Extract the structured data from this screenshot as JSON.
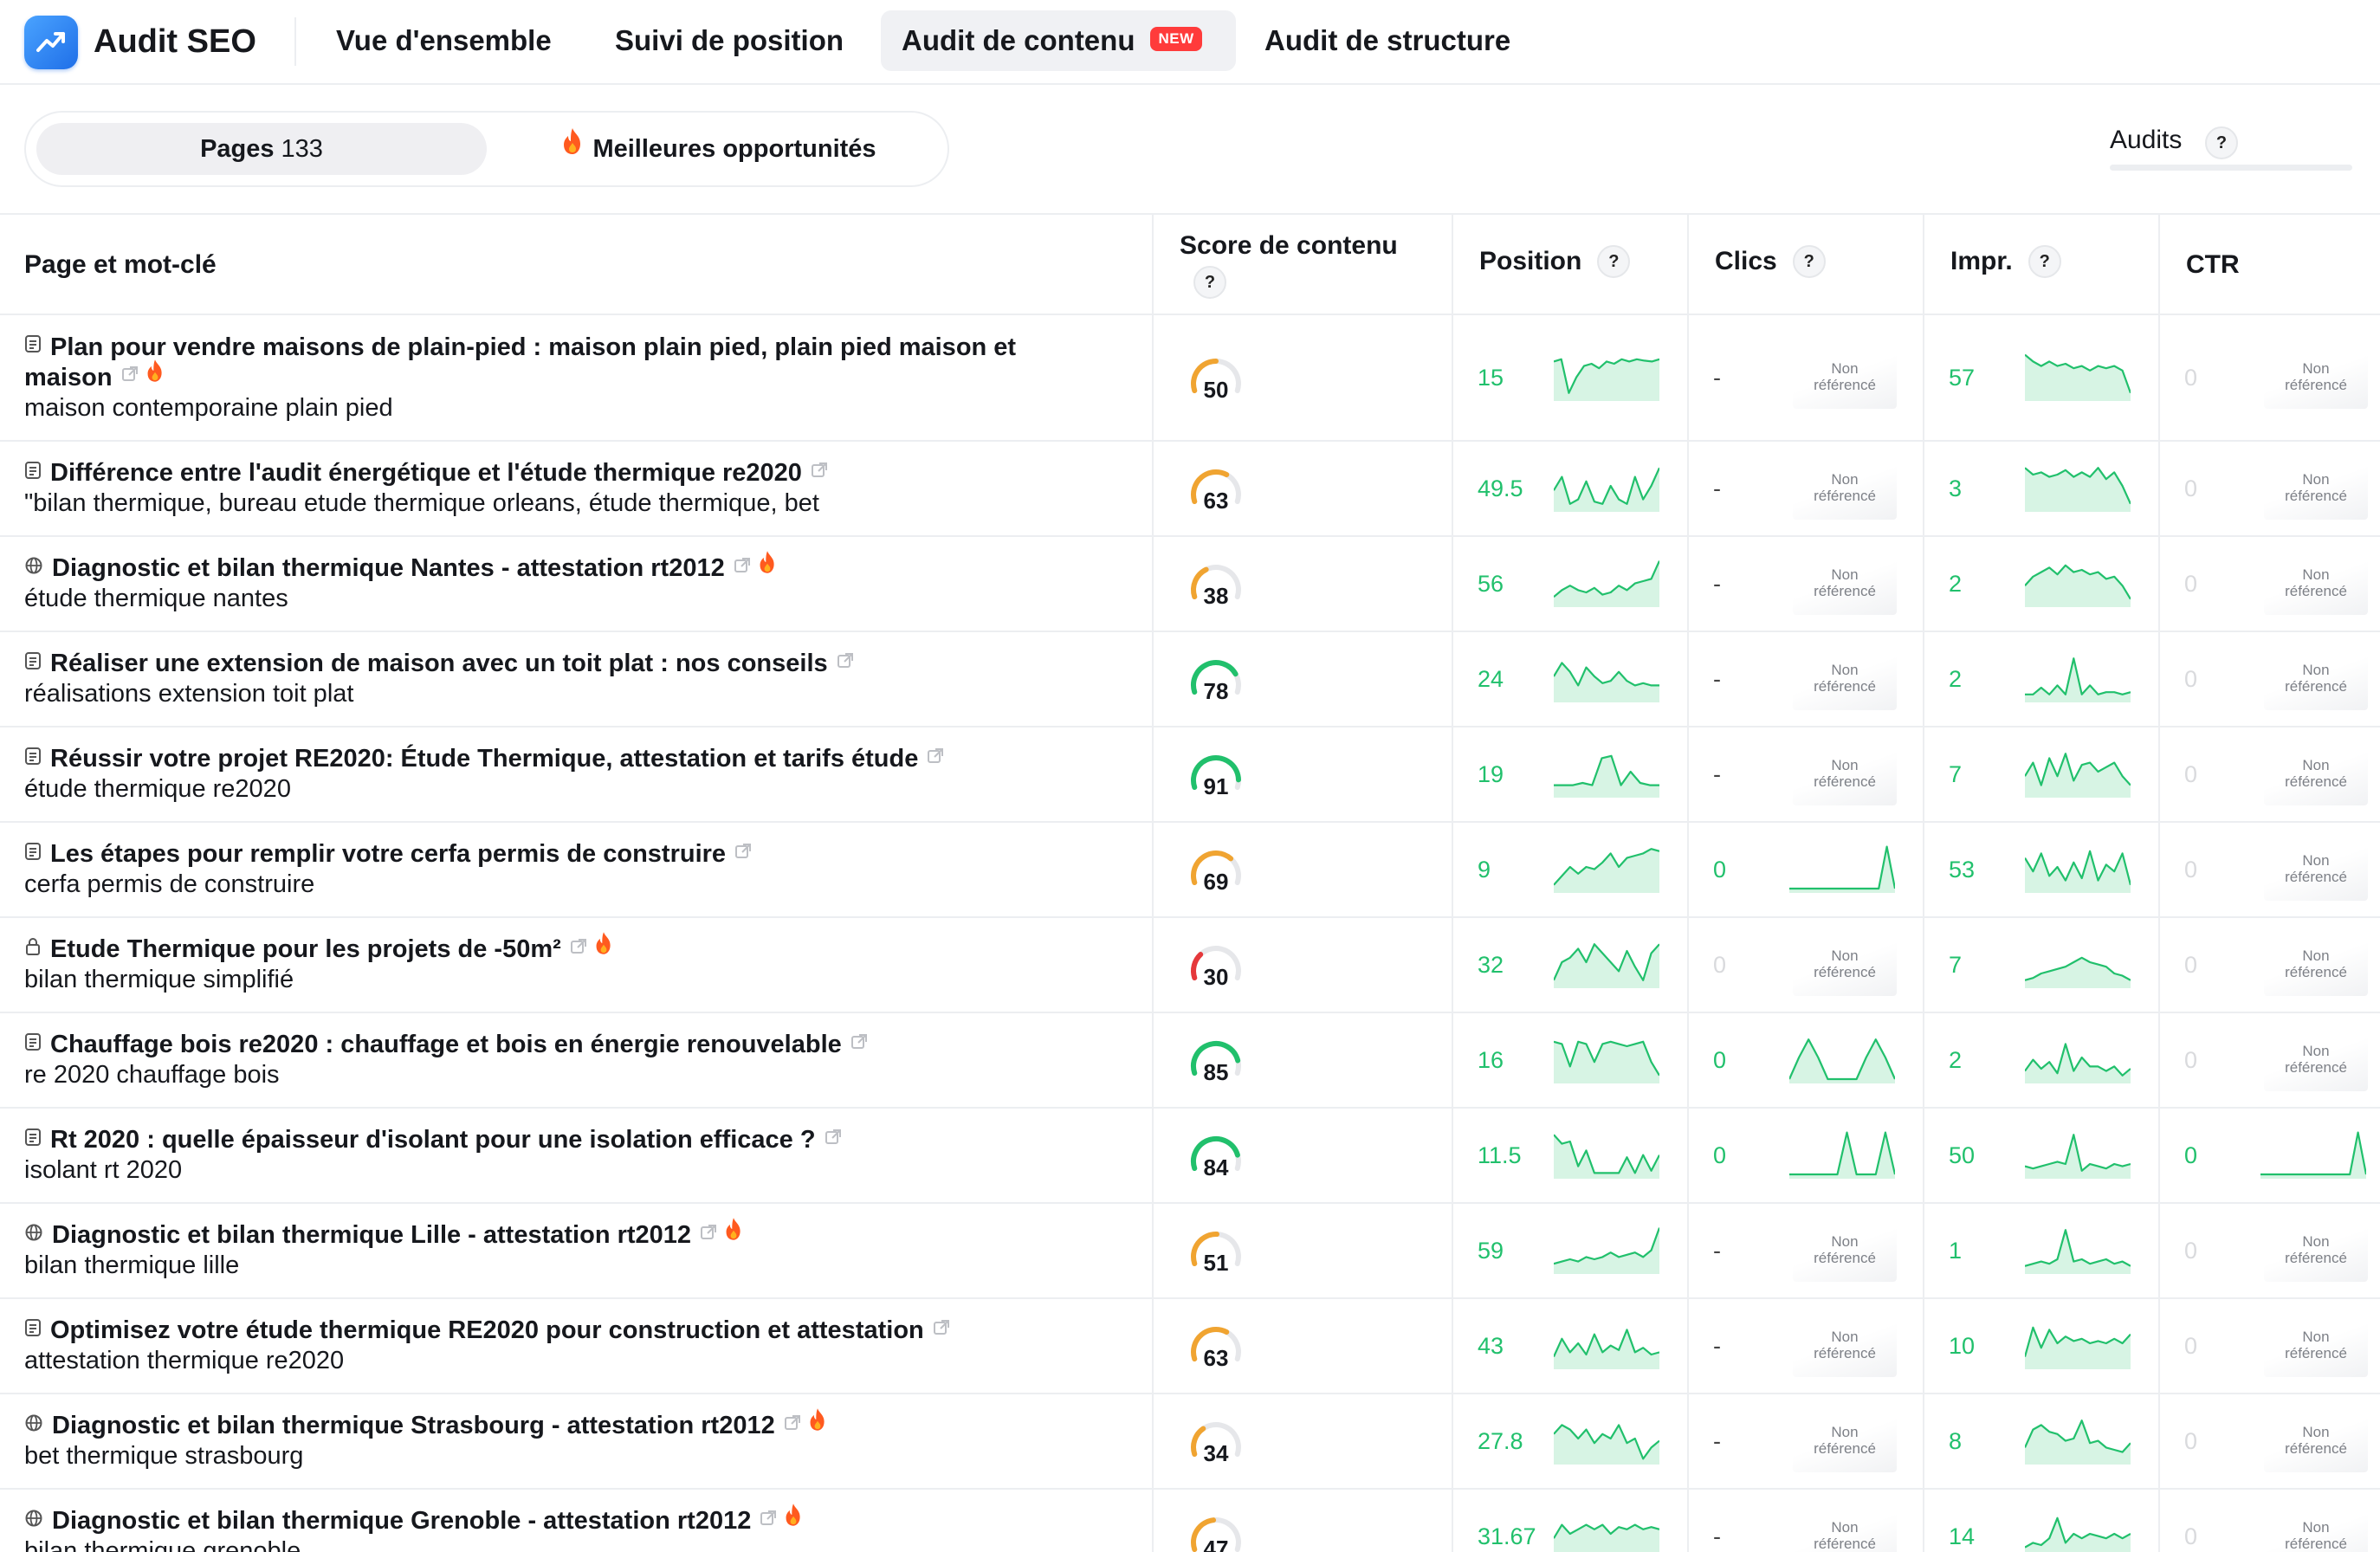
{
  "app": {
    "title": "Audit SEO"
  },
  "nav": {
    "tabs": [
      {
        "label": "Vue d'ensemble",
        "active": false
      },
      {
        "label": "Suivi de position",
        "active": false
      },
      {
        "label": "Audit de contenu",
        "active": true,
        "badge": "NEW"
      },
      {
        "label": "Audit de structure",
        "active": false
      }
    ]
  },
  "filters": {
    "pages_label": "Pages",
    "pages_count": "133",
    "opportunities_label": "Meilleures opportunités"
  },
  "audits": {
    "label": "Audits",
    "help": "?"
  },
  "table": {
    "columns": {
      "page": "Page et mot-clé",
      "score": "Score de contenu",
      "position": "Position",
      "clicks": "Clics",
      "impressions": "Impr.",
      "ctr": "CTR"
    },
    "help": "?",
    "non_ref_1": "Non",
    "non_ref_2": "référencé",
    "rows": [
      {
        "icon": "doc-icon",
        "title_1": "Plan pour vendre maisons de plain-pied : maison plain pied, plain pied maison et",
        "title_2": "maison",
        "fire": true,
        "keyword": "maison contemporaine plain pied",
        "score": "50",
        "score_value": 50,
        "score_color": "#f0a431",
        "position": "15",
        "clicks": "-",
        "impressions": "57",
        "ctr": "0",
        "pos_trend": [
          0.2,
          0.15,
          0.9,
          0.55,
          0.3,
          0.25,
          0.35,
          0.2,
          0.25,
          0.15,
          0.2,
          0.15,
          0.18,
          0.2,
          0.15
        ],
        "clicks_trend": null,
        "impr_trend": [
          0.05,
          0.2,
          0.3,
          0.2,
          0.3,
          0.25,
          0.35,
          0.3,
          0.4,
          0.3,
          0.35,
          0.3,
          0.4,
          0.9
        ],
        "ctr_trend": null
      },
      {
        "icon": "doc-icon",
        "title_1": "Différence entre l'audit énergétique et l'étude thermique re2020",
        "title_2": "",
        "fire": false,
        "keyword": "\"bilan thermique, bureau etude thermique orleans, étude thermique, bet",
        "score": "63",
        "score_value": 63,
        "score_color": "#f0a431",
        "position": "49.5",
        "clicks": "-",
        "impressions": "3",
        "ctr": "0",
        "pos_trend": [
          0.6,
          0.3,
          0.9,
          0.8,
          0.4,
          0.85,
          0.9,
          0.5,
          0.8,
          0.9,
          0.3,
          0.8,
          0.5,
          0.1
        ],
        "clicks_trend": null,
        "impr_trend": [
          0.1,
          0.25,
          0.2,
          0.3,
          0.25,
          0.15,
          0.3,
          0.2,
          0.3,
          0.1,
          0.35,
          0.2,
          0.5,
          0.9
        ],
        "ctr_trend": null
      },
      {
        "icon": "globe-icon",
        "title_1": "Diagnostic et bilan thermique Nantes - attestation rt2012",
        "title_2": "",
        "fire": true,
        "keyword": "étude thermique nantes",
        "score": "38",
        "score_value": 38,
        "score_color": "#f0a431",
        "position": "56",
        "clicks": "-",
        "impressions": "2",
        "ctr": "0",
        "pos_trend": [
          0.85,
          0.7,
          0.6,
          0.7,
          0.75,
          0.65,
          0.8,
          0.75,
          0.6,
          0.7,
          0.55,
          0.5,
          0.45,
          0.05
        ],
        "clicks_trend": null,
        "impr_trend": [
          0.6,
          0.4,
          0.3,
          0.2,
          0.35,
          0.15,
          0.3,
          0.25,
          0.35,
          0.3,
          0.45,
          0.4,
          0.6,
          0.9
        ],
        "ctr_trend": null
      },
      {
        "icon": "doc-icon",
        "title_1": "Réaliser une extension de maison avec un toit plat : nos conseils",
        "title_2": "",
        "fire": false,
        "keyword": "réalisations extension toit plat",
        "score": "78",
        "score_value": 78,
        "score_color": "#21c06c",
        "position": "24",
        "clicks": "-",
        "impressions": "2",
        "ctr": "0",
        "pos_trend": [
          0.5,
          0.2,
          0.4,
          0.7,
          0.3,
          0.5,
          0.65,
          0.6,
          0.4,
          0.6,
          0.7,
          0.65,
          0.7,
          0.7
        ],
        "clicks_trend": null,
        "impr_trend": [
          0.9,
          0.9,
          0.75,
          0.9,
          0.7,
          0.9,
          0.1,
          0.9,
          0.7,
          0.9,
          0.85,
          0.85,
          0.9,
          0.85
        ],
        "ctr_trend": null
      },
      {
        "icon": "doc-icon",
        "title_1": "Réussir votre projet RE2020: Étude Thermique, attestation et tarifs étude",
        "title_2": "",
        "fire": false,
        "keyword": "étude thermique re2020",
        "score": "91",
        "score_value": 91,
        "score_color": "#21c06c",
        "position": "19",
        "clicks": "-",
        "impressions": "7",
        "ctr": "0",
        "pos_trend": [
          0.8,
          0.8,
          0.8,
          0.75,
          0.8,
          0.2,
          0.15,
          0.8,
          0.5,
          0.75,
          0.8,
          0.8
        ],
        "clicks_trend": null,
        "impr_trend": [
          0.6,
          0.3,
          0.8,
          0.2,
          0.6,
          0.1,
          0.7,
          0.35,
          0.3,
          0.5,
          0.4,
          0.3,
          0.6,
          0.8
        ],
        "ctr_trend": null
      },
      {
        "icon": "doc-icon",
        "title_1": "Les étapes pour remplir votre cerfa permis de construire",
        "title_2": "",
        "fire": false,
        "keyword": "cerfa permis de construire",
        "score": "69",
        "score_value": 69,
        "score_color": "#f0a431",
        "position": "9",
        "clicks": "0",
        "impressions": "53",
        "ctr": "0",
        "pos_trend": [
          0.9,
          0.7,
          0.5,
          0.65,
          0.5,
          0.55,
          0.4,
          0.2,
          0.5,
          0.3,
          0.25,
          0.2,
          0.1,
          0.15
        ],
        "clicks_trend": [
          0.98,
          0.98,
          0.98,
          0.98,
          0.98,
          0.98,
          0.98,
          0.98,
          0.98,
          0.98,
          0.98,
          0.98,
          0.05,
          0.98
        ],
        "impr_trend": [
          0.3,
          0.6,
          0.2,
          0.7,
          0.5,
          0.8,
          0.4,
          0.75,
          0.15,
          0.8,
          0.45,
          0.6,
          0.2,
          0.9
        ],
        "ctr_trend": null
      },
      {
        "icon": "lock-icon",
        "title_1": "Etude Thermique pour les projets de -50m²",
        "title_2": "",
        "fire": true,
        "keyword": "bilan thermique simplifié",
        "score": "30",
        "score_value": 30,
        "score_color": "#e5383b",
        "position": "32",
        "clicks": "0",
        "clicks_grey": true,
        "impressions": "7",
        "ctr": "0",
        "pos_trend": [
          0.9,
          0.5,
          0.4,
          0.2,
          0.5,
          0.1,
          0.3,
          0.5,
          0.7,
          0.25,
          0.6,
          0.9,
          0.3,
          0.1
        ],
        "clicks_trend": null,
        "impr_trend": [
          0.9,
          0.85,
          0.75,
          0.7,
          0.65,
          0.6,
          0.5,
          0.4,
          0.5,
          0.55,
          0.6,
          0.75,
          0.8,
          0.9
        ],
        "ctr_trend": null
      },
      {
        "icon": "doc-icon",
        "title_1": "Chauffage bois re2020 : chauffage et bois en énergie renouvelable",
        "title_2": "",
        "fire": false,
        "keyword": "re 2020 chauffage bois",
        "score": "85",
        "score_value": 85,
        "score_color": "#21c06c",
        "position": "16",
        "clicks": "0",
        "impressions": "2",
        "ctr": "0",
        "pos_trend": [
          0.15,
          0.2,
          0.7,
          0.15,
          0.2,
          0.6,
          0.2,
          0.15,
          0.2,
          0.25,
          0.2,
          0.15,
          0.6,
          0.9
        ],
        "clicks_trend": [
          0.98,
          0.5,
          0.1,
          0.5,
          0.98,
          0.98,
          0.98,
          0.98,
          0.5,
          0.1,
          0.5,
          0.98
        ],
        "impr_trend": [
          0.8,
          0.55,
          0.75,
          0.6,
          0.85,
          0.2,
          0.8,
          0.5,
          0.7,
          0.7,
          0.8,
          0.7,
          0.9,
          0.75
        ],
        "ctr_trend": null
      },
      {
        "icon": "doc-icon",
        "title_1": "Rt 2020 : quelle épaisseur d'isolant pour une isolation efficace ?",
        "title_2": "",
        "fire": false,
        "keyword": "isolant rt 2020",
        "score": "84",
        "score_value": 84,
        "score_color": "#21c06c",
        "position": "11.5",
        "clicks": "0",
        "impressions": "50",
        "ctr": "0",
        "ctr_green": true,
        "pos_trend": [
          0.1,
          0.3,
          0.25,
          0.8,
          0.45,
          0.95,
          0.95,
          0.95,
          0.95,
          0.6,
          0.95,
          0.55,
          0.9,
          0.55
        ],
        "clicks_trend": [
          0.98,
          0.98,
          0.98,
          0.98,
          0.98,
          0.98,
          0.05,
          0.98,
          0.98,
          0.98,
          0.05,
          0.98
        ],
        "impr_trend": [
          0.8,
          0.85,
          0.8,
          0.75,
          0.7,
          0.75,
          0.1,
          0.9,
          0.75,
          0.8,
          0.85,
          0.75,
          0.8,
          0.75
        ],
        "ctr_trend": [
          0.98,
          0.98,
          0.98,
          0.98,
          0.98,
          0.98,
          0.98,
          0.98,
          0.98,
          0.98,
          0.98,
          0.98,
          0.05,
          0.98
        ]
      },
      {
        "icon": "globe-icon",
        "title_1": "Diagnostic et bilan thermique Lille - attestation rt2012",
        "title_2": "",
        "fire": true,
        "keyword": "bilan thermique lille",
        "score": "51",
        "score_value": 51,
        "score_color": "#f0a431",
        "position": "59",
        "clicks": "-",
        "impressions": "1",
        "ctr": "0",
        "pos_trend": [
          0.85,
          0.8,
          0.75,
          0.8,
          0.7,
          0.75,
          0.7,
          0.6,
          0.7,
          0.65,
          0.6,
          0.7,
          0.55,
          0.05
        ],
        "clicks_trend": null,
        "impr_trend": [
          0.9,
          0.85,
          0.8,
          0.85,
          0.75,
          0.1,
          0.8,
          0.75,
          0.85,
          0.8,
          0.75,
          0.85,
          0.8,
          0.9
        ],
        "ctr_trend": null
      },
      {
        "icon": "doc-icon",
        "title_1": "Optimisez votre étude thermique RE2020 pour construction et attestation",
        "title_2": "",
        "fire": false,
        "keyword": "attestation thermique re2020",
        "score": "63",
        "score_value": 63,
        "score_color": "#f0a431",
        "position": "43",
        "clicks": "-",
        "impressions": "10",
        "ctr": "0",
        "pos_trend": [
          0.8,
          0.4,
          0.7,
          0.5,
          0.75,
          0.3,
          0.7,
          0.55,
          0.65,
          0.2,
          0.7,
          0.6,
          0.75,
          0.7
        ],
        "clicks_trend": null,
        "impr_trend": [
          0.8,
          0.15,
          0.6,
          0.2,
          0.5,
          0.35,
          0.45,
          0.4,
          0.5,
          0.45,
          0.5,
          0.4,
          0.5,
          0.3
        ],
        "ctr_trend": null
      },
      {
        "icon": "globe-icon",
        "title_1": "Diagnostic et bilan thermique Strasbourg - attestation rt2012",
        "title_2": "",
        "fire": true,
        "keyword": "bet thermique strasbourg",
        "score": "34",
        "score_value": 34,
        "score_color": "#f0a431",
        "position": "27.8",
        "clicks": "-",
        "impressions": "8",
        "ctr": "0",
        "pos_trend": [
          0.4,
          0.2,
          0.3,
          0.5,
          0.3,
          0.6,
          0.4,
          0.5,
          0.2,
          0.6,
          0.5,
          0.95,
          0.7,
          0.55
        ],
        "clicks_trend": null,
        "impr_trend": [
          0.7,
          0.3,
          0.2,
          0.35,
          0.4,
          0.55,
          0.5,
          0.1,
          0.6,
          0.55,
          0.7,
          0.75,
          0.8,
          0.6
        ],
        "ctr_trend": null
      },
      {
        "icon": "globe-icon",
        "title_1": "Diagnostic et bilan thermique Grenoble - attestation rt2012",
        "title_2": "",
        "fire": true,
        "keyword": "bilan thermique grenoble",
        "score": "47",
        "score_value": 47,
        "score_color": "#f0a431",
        "position": "31.67",
        "clicks": "-",
        "impressions": "14",
        "ctr": "0",
        "pos_trend": [
          0.6,
          0.3,
          0.5,
          0.4,
          0.3,
          0.4,
          0.3,
          0.5,
          0.35,
          0.4,
          0.3,
          0.4,
          0.35,
          0.4
        ],
        "clicks_trend": null,
        "impr_trend": [
          0.8,
          0.7,
          0.75,
          0.6,
          0.15,
          0.7,
          0.5,
          0.6,
          0.5,
          0.55,
          0.6,
          0.5,
          0.6,
          0.5
        ],
        "ctr_trend": null
      }
    ]
  },
  "colors": {
    "green": "#21c06c",
    "orange": "#f0a431",
    "red": "#e5383b",
    "badge": "#ff3b3b",
    "logo": "#2b82f0"
  }
}
